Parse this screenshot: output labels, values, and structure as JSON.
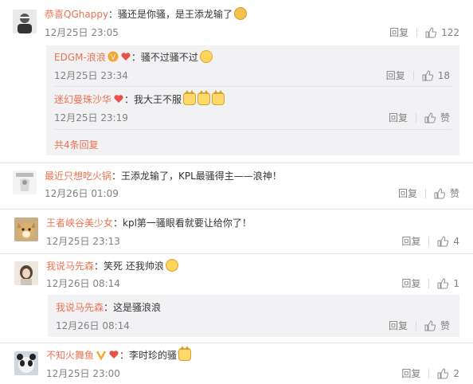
{
  "comments": [
    {
      "user": "恭喜QGhappy",
      "text": "：骚还是你骚，是王添龙输了",
      "time": "12月25日 23:05",
      "reply": "回复",
      "likes": "122"
    },
    {
      "user": "最近只想吃火锅",
      "text": "：王添龙输了，KPL最骚得主——浪神！",
      "time": "12月26日 01:09",
      "reply": "回复",
      "likes": "赞"
    },
    {
      "user": "王者峡谷美少女",
      "text": "：kpl第一骚眼看就要让给你了！",
      "time": "12月25日 23:13",
      "reply": "回复",
      "likes": "4"
    },
    {
      "user": "我说马先森",
      "text": "：笑死  还我帅浪",
      "time": "12月26日 08:14",
      "reply": "回复",
      "likes": "1"
    },
    {
      "user": "不知火舞鱼",
      "text": "：李时珍的骚",
      "time": "12月25日 23:00",
      "reply": "回复",
      "likes": "2"
    }
  ],
  "replies": [
    {
      "user": "EDGM-浪浪",
      "text": "：骚不过骚不过",
      "time": "12月25日 23:34",
      "reply": "回复",
      "likes": "18"
    },
    {
      "user": "迷幻曼珠沙华",
      "text": "：我大王不服",
      "time": "12月25日 23:19",
      "reply": "回复",
      "likes": "赞"
    },
    {
      "user": "我说马先森",
      "text": "：这是骚浪浪",
      "time": "12月26日 08:14",
      "reply": "回复",
      "likes": "赞"
    }
  ],
  "total_replies": "共4条回复",
  "colors": {
    "username": "#eb7350",
    "meta": "#808080",
    "reply_bg": "#f2f2f5"
  }
}
